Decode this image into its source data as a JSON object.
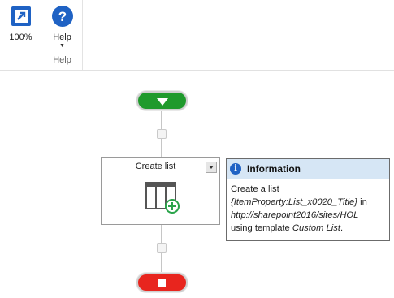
{
  "ribbon": {
    "zoom_label": "100%",
    "help_label": "Help",
    "help_group_label": "Help"
  },
  "workflow": {
    "action_title": "Create list"
  },
  "info": {
    "header": "Information",
    "line1": "Create a list",
    "item_property": "{ItemProperty:List_x0020_Title}",
    "in_word": "in",
    "url": "http://sharepoint2016/sites/HOL",
    "using_template": "using template",
    "template_name": "Custom List",
    "period": "."
  },
  "colors": {
    "start": "#1f9a2c",
    "stop": "#e8251e",
    "info_header": "#d6e6f5",
    "accent_blue": "#1f62c4",
    "add_green": "#2aa44a"
  }
}
